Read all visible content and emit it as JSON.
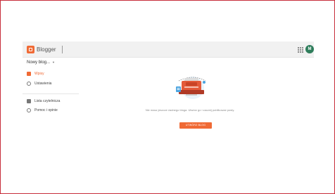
{
  "header": {
    "brand": "Blogger",
    "avatar_initial": "M",
    "apps_icon": "apps-grid-icon",
    "logo_icon": "blogger-logo-icon"
  },
  "sidebar": {
    "blog_selector": "Nowy blog...",
    "items": [
      {
        "label": "Wpisy",
        "icon": "posts-icon",
        "active": true
      },
      {
        "label": "Ustawienia",
        "icon": "settings-icon",
        "active": false
      },
      {
        "label": "Lista czytelnicza",
        "icon": "reading-list-icon",
        "active": false
      },
      {
        "label": "Pomoc i opinie",
        "icon": "help-icon",
        "active": false
      }
    ]
  },
  "main": {
    "empty_message": "Nie masz jeszcze żadnego bloga. Utwórz go i zacznij publikować posty.",
    "create_button": "UTWÓRZ BLOG"
  },
  "colors": {
    "accent": "#f06a35",
    "frame_border": "#c72d3a",
    "avatar": "#2e7d5b"
  }
}
